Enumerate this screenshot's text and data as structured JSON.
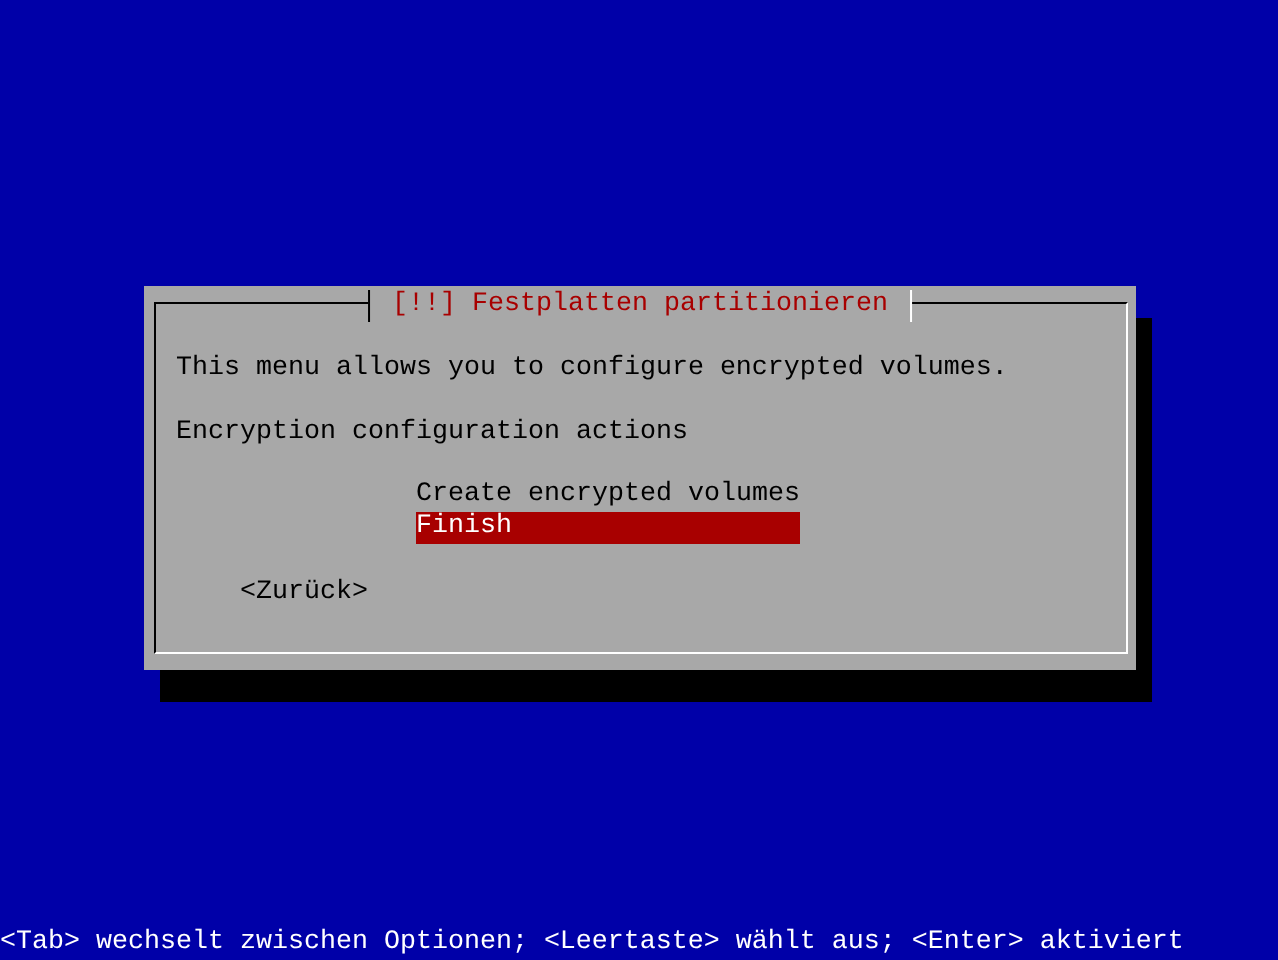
{
  "dialog": {
    "title": "[!!] Festplatten partitionieren",
    "description": "This menu allows you to configure encrypted volumes.",
    "prompt": "Encryption configuration actions",
    "menu": [
      {
        "label": "Create encrypted volumes",
        "selected": false
      },
      {
        "label": "Finish",
        "selected": true
      }
    ],
    "back_button": "<Zurück>"
  },
  "help_line": "<Tab> wechselt zwischen Optionen; <Leertaste> wählt aus; <Enter> aktiviert"
}
